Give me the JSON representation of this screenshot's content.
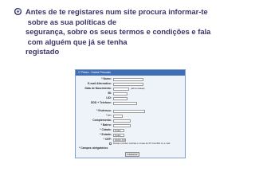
{
  "slide": {
    "bullet_icon": "swirl-bullet-icon",
    "bullet_color": "#3b3468",
    "lines": [
      "Antes de te registares num site procura informar-te",
      " sobre as sua políticas de",
      "segurança, sobre os seus termos e condições e fala",
      " com alguém que já se tenha",
      "registado"
    ]
  },
  "form": {
    "header": "1º Passo - Dados Pessoais",
    "fields": [
      {
        "label": "* Nome:",
        "value": ""
      },
      {
        "label": "E-mail Alternativo:",
        "value": ""
      },
      {
        "label": "Data de Nascimento:",
        "value": "(dd/mm/aaaa)"
      },
      {
        "label": "BI:",
        "value": ""
      },
      {
        "label": "LID:",
        "value": ""
      },
      {
        "label": "DDD + Telefone:",
        "value": ""
      },
      {
        "label": "* Endereço:",
        "value": ""
      },
      {
        "label": "* nº:",
        "value": ""
      },
      {
        "label": "Complemento:",
        "value": ""
      },
      {
        "label": "* Bairro:",
        "value": ""
      },
      {
        "label": "* Cidade:",
        "value": "Todos"
      },
      {
        "label": "* Estado:",
        "value": "Todos"
      },
      {
        "label": "* CEP:",
        "value": "00000-000"
      }
    ],
    "optin_label": "Desejo receber notícias e novas do R7.ComRH no e-mail",
    "required_note": "* Campos obrigatórios",
    "submit_label": "Cadastrar"
  }
}
